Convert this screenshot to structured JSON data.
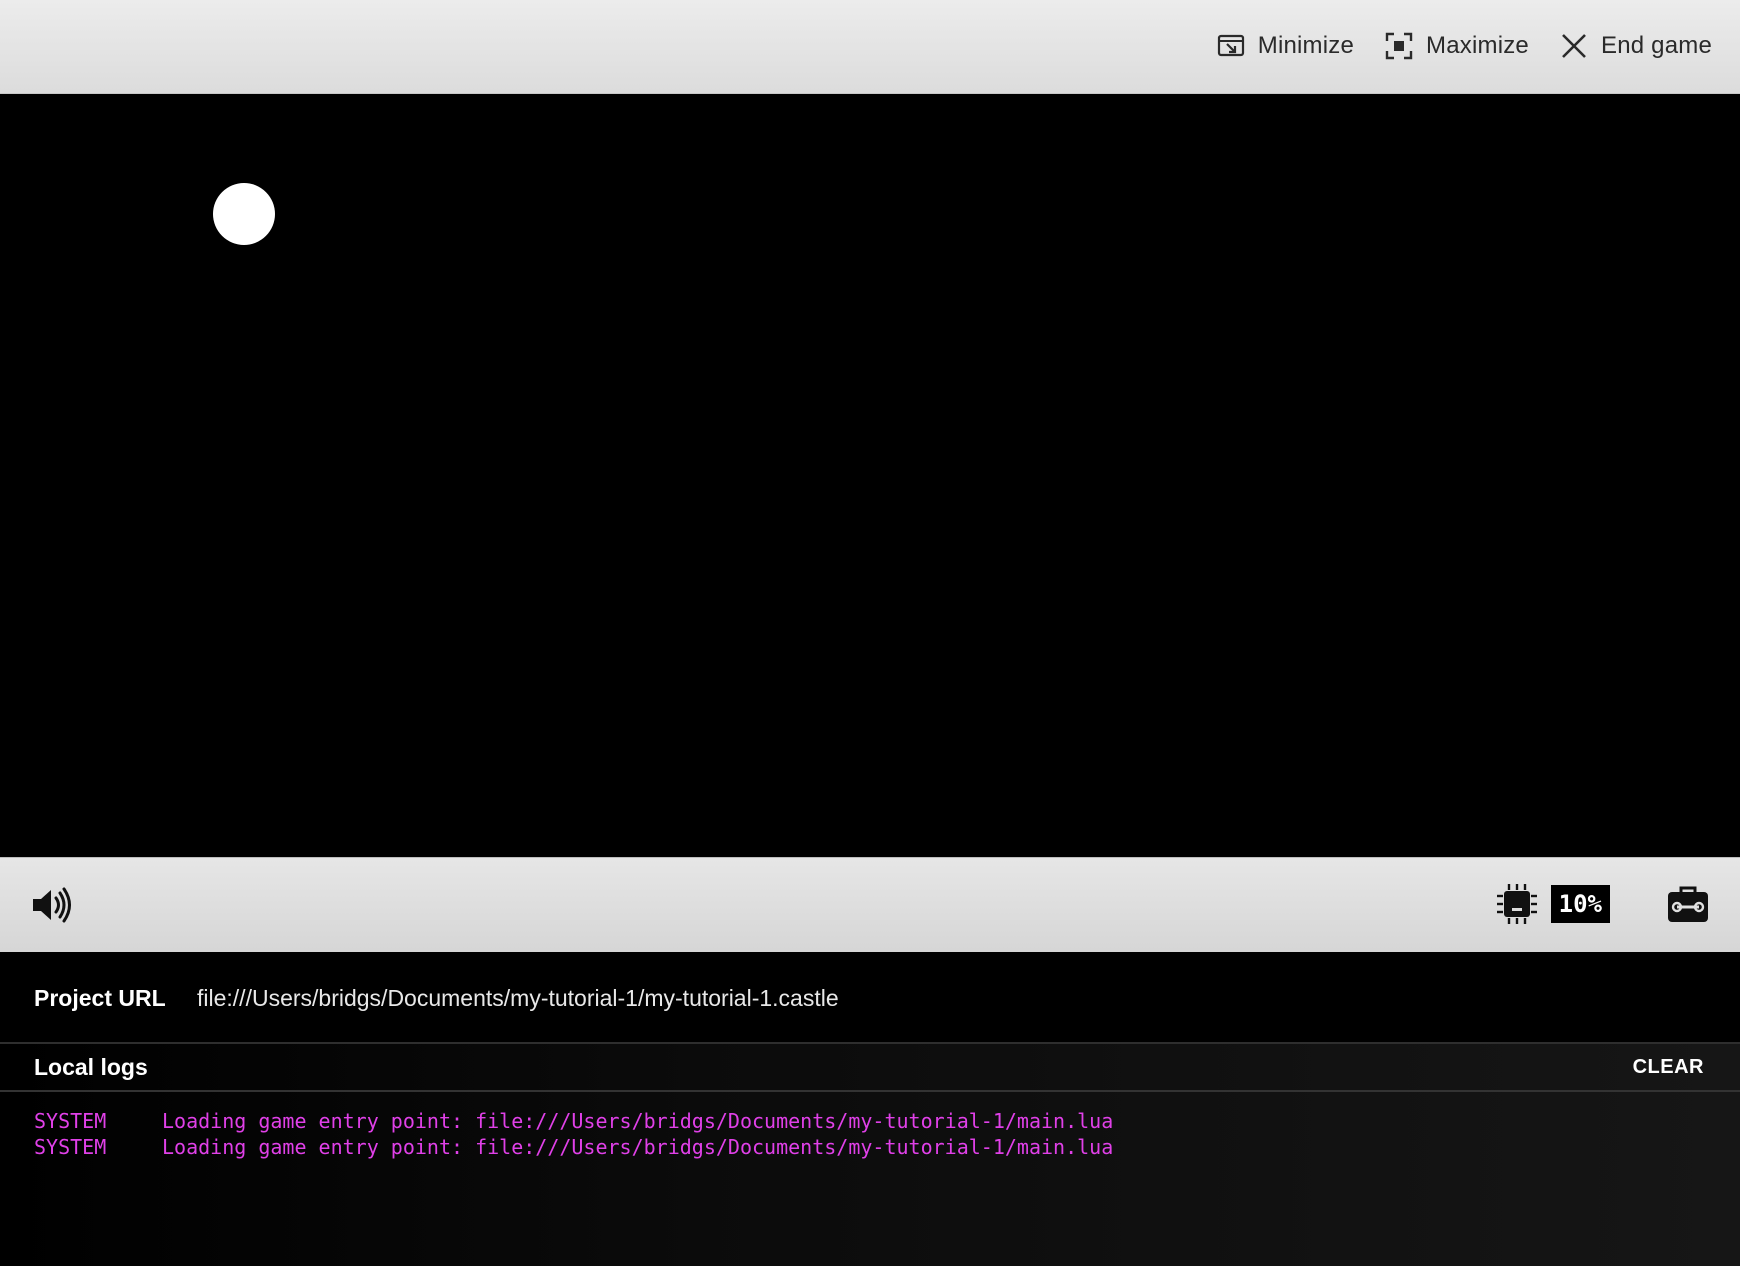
{
  "topbar": {
    "actions": [
      {
        "label": "Minimize",
        "icon": "minimize-icon"
      },
      {
        "label": "Maximize",
        "icon": "maximize-icon"
      },
      {
        "label": "End game",
        "icon": "close-icon"
      }
    ]
  },
  "controls": {
    "volume_icon": "volume-icon",
    "cpu_icon": "cpu-chip-icon",
    "cpu_usage": "10%",
    "tools_icon": "toolbox-icon"
  },
  "project": {
    "label": "Project URL",
    "url": "file:///Users/bridgs/Documents/my-tutorial-1/my-tutorial-1.castle"
  },
  "logs": {
    "title": "Local logs",
    "clear_label": "CLEAR",
    "entries": [
      {
        "source": "SYSTEM",
        "message": "Loading game entry point: file:///Users/bridgs/Documents/my-tutorial-1/main.lua"
      },
      {
        "source": "SYSTEM",
        "message": "Loading game entry point: file:///Users/bridgs/Documents/my-tutorial-1/main.lua"
      }
    ]
  },
  "colors": {
    "log_text": "#e040e8",
    "game_background": "#000000",
    "ball": "#ffffff"
  }
}
